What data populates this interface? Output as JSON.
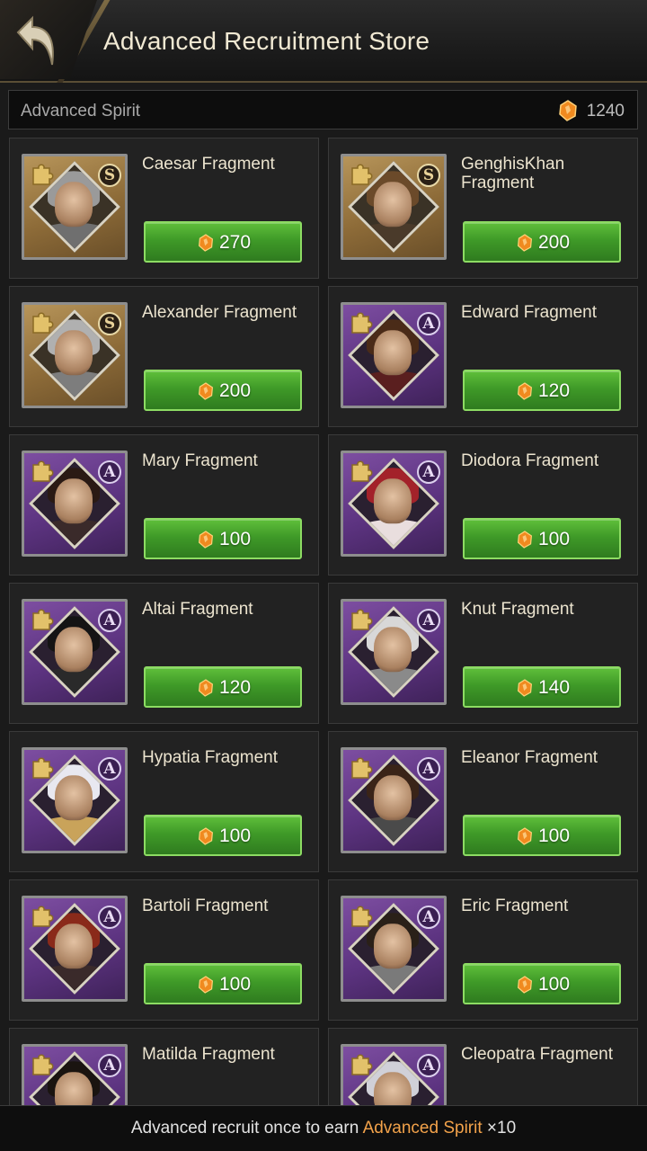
{
  "header": {
    "title": "Advanced Recruitment Store"
  },
  "currency": {
    "label": "Advanced Spirit",
    "amount": "1240",
    "icon": "spirit-gem-icon"
  },
  "items": [
    {
      "name": "Caesar Fragment",
      "price": "270",
      "rank": "S"
    },
    {
      "name": "GenghisKhan Fragment",
      "price": "200",
      "rank": "S"
    },
    {
      "name": "Alexander Fragment",
      "price": "200",
      "rank": "S"
    },
    {
      "name": "Edward Fragment",
      "price": "120",
      "rank": "A"
    },
    {
      "name": "Mary Fragment",
      "price": "100",
      "rank": "A"
    },
    {
      "name": "Diodora Fragment",
      "price": "100",
      "rank": "A"
    },
    {
      "name": "Altai Fragment",
      "price": "120",
      "rank": "A"
    },
    {
      "name": "Knut Fragment",
      "price": "140",
      "rank": "A"
    },
    {
      "name": "Hypatia Fragment",
      "price": "100",
      "rank": "A"
    },
    {
      "name": "Eleanor Fragment",
      "price": "100",
      "rank": "A"
    },
    {
      "name": "Bartoli Fragment",
      "price": "100",
      "rank": "A"
    },
    {
      "name": "Eric Fragment",
      "price": "100",
      "rank": "A"
    },
    {
      "name": "Matilda Fragment",
      "price": "",
      "rank": "A"
    },
    {
      "name": "Cleopatra Fragment",
      "price": "",
      "rank": "A"
    }
  ],
  "footer": {
    "prefix": "Advanced recruit once to earn ",
    "highlight": "Advanced Spirit",
    "suffix": " ×10"
  },
  "colors": {
    "accent_green": "#4caf2e",
    "highlight_orange": "#f2a24a",
    "rank_s": "#b7955a",
    "rank_a": "#6a3f8e"
  }
}
